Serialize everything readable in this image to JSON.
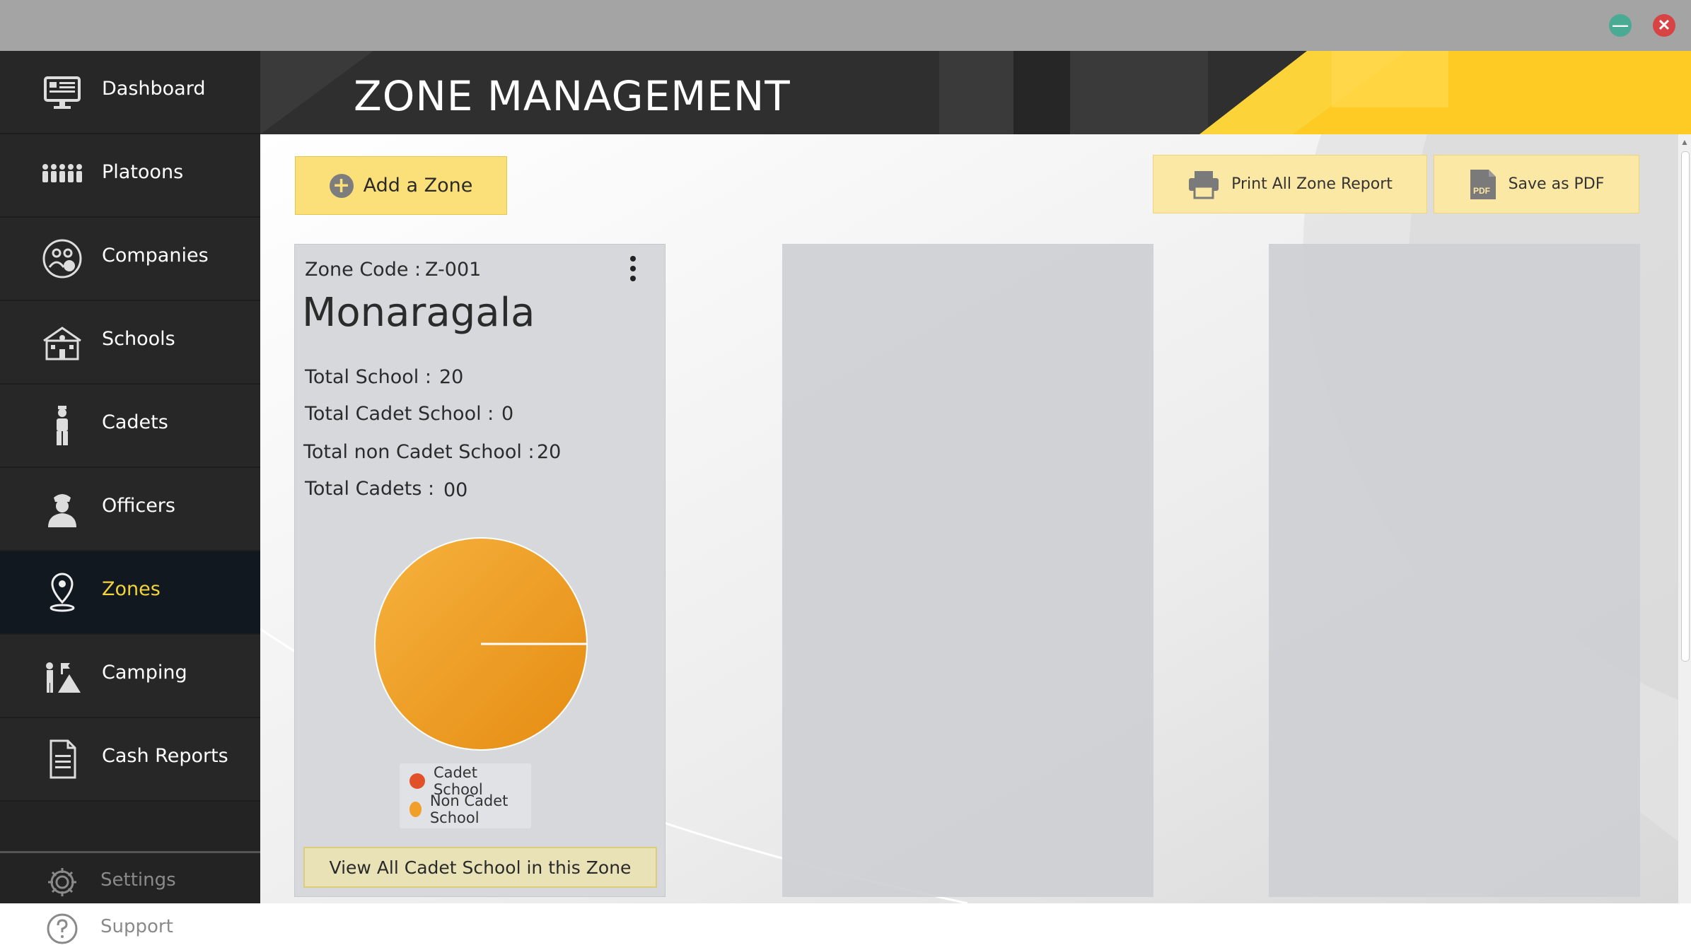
{
  "window": {
    "minimize_label": "—",
    "close_label": "✕"
  },
  "sidebar": {
    "items": [
      {
        "label": "Dashboard",
        "icon": "monitor-icon"
      },
      {
        "label": "Platoons",
        "icon": "people-group-icon"
      },
      {
        "label": "Companies",
        "icon": "company-icon"
      },
      {
        "label": "Schools",
        "icon": "school-icon"
      },
      {
        "label": "Cadets",
        "icon": "cadet-icon"
      },
      {
        "label": "Officers",
        "icon": "officer-icon"
      },
      {
        "label": "Zones",
        "icon": "location-pin-icon",
        "active": true
      },
      {
        "label": "Camping",
        "icon": "camping-icon"
      },
      {
        "label": "Cash Reports",
        "icon": "document-icon"
      }
    ],
    "footer": [
      {
        "label": "Settings",
        "icon": "gear-icon"
      },
      {
        "label": "Support",
        "icon": "help-icon"
      }
    ]
  },
  "header": {
    "title": "ZONE MANAGEMENT"
  },
  "toolbar": {
    "add_label": "Add a Zone",
    "print_label": "Print All Zone Report",
    "pdf_label": "Save as PDF"
  },
  "zone_card": {
    "code_label": "Zone Code :",
    "code_value": "Z-001",
    "name": "Monaragala",
    "stats": [
      {
        "label": "Total School :",
        "value": "20"
      },
      {
        "label": "Total Cadet School :",
        "value": "0"
      },
      {
        "label": "Total non Cadet School :",
        "value": "20"
      },
      {
        "label": "Total Cadets :",
        "value": "00"
      }
    ],
    "view_button": "View All Cadet School in this Zone"
  },
  "chart_data": {
    "type": "pie",
    "labels": [
      "Cadet School",
      "Non Cadet School"
    ],
    "values": [
      0,
      20
    ],
    "colors": [
      "#e2502a",
      "#f0a028"
    ],
    "legend": "bottom"
  },
  "colors": {
    "accent": "#f2d43a",
    "button_yellow": "#fbe07a",
    "sidebar_bg": "#272727",
    "active_bg": "#111820"
  }
}
